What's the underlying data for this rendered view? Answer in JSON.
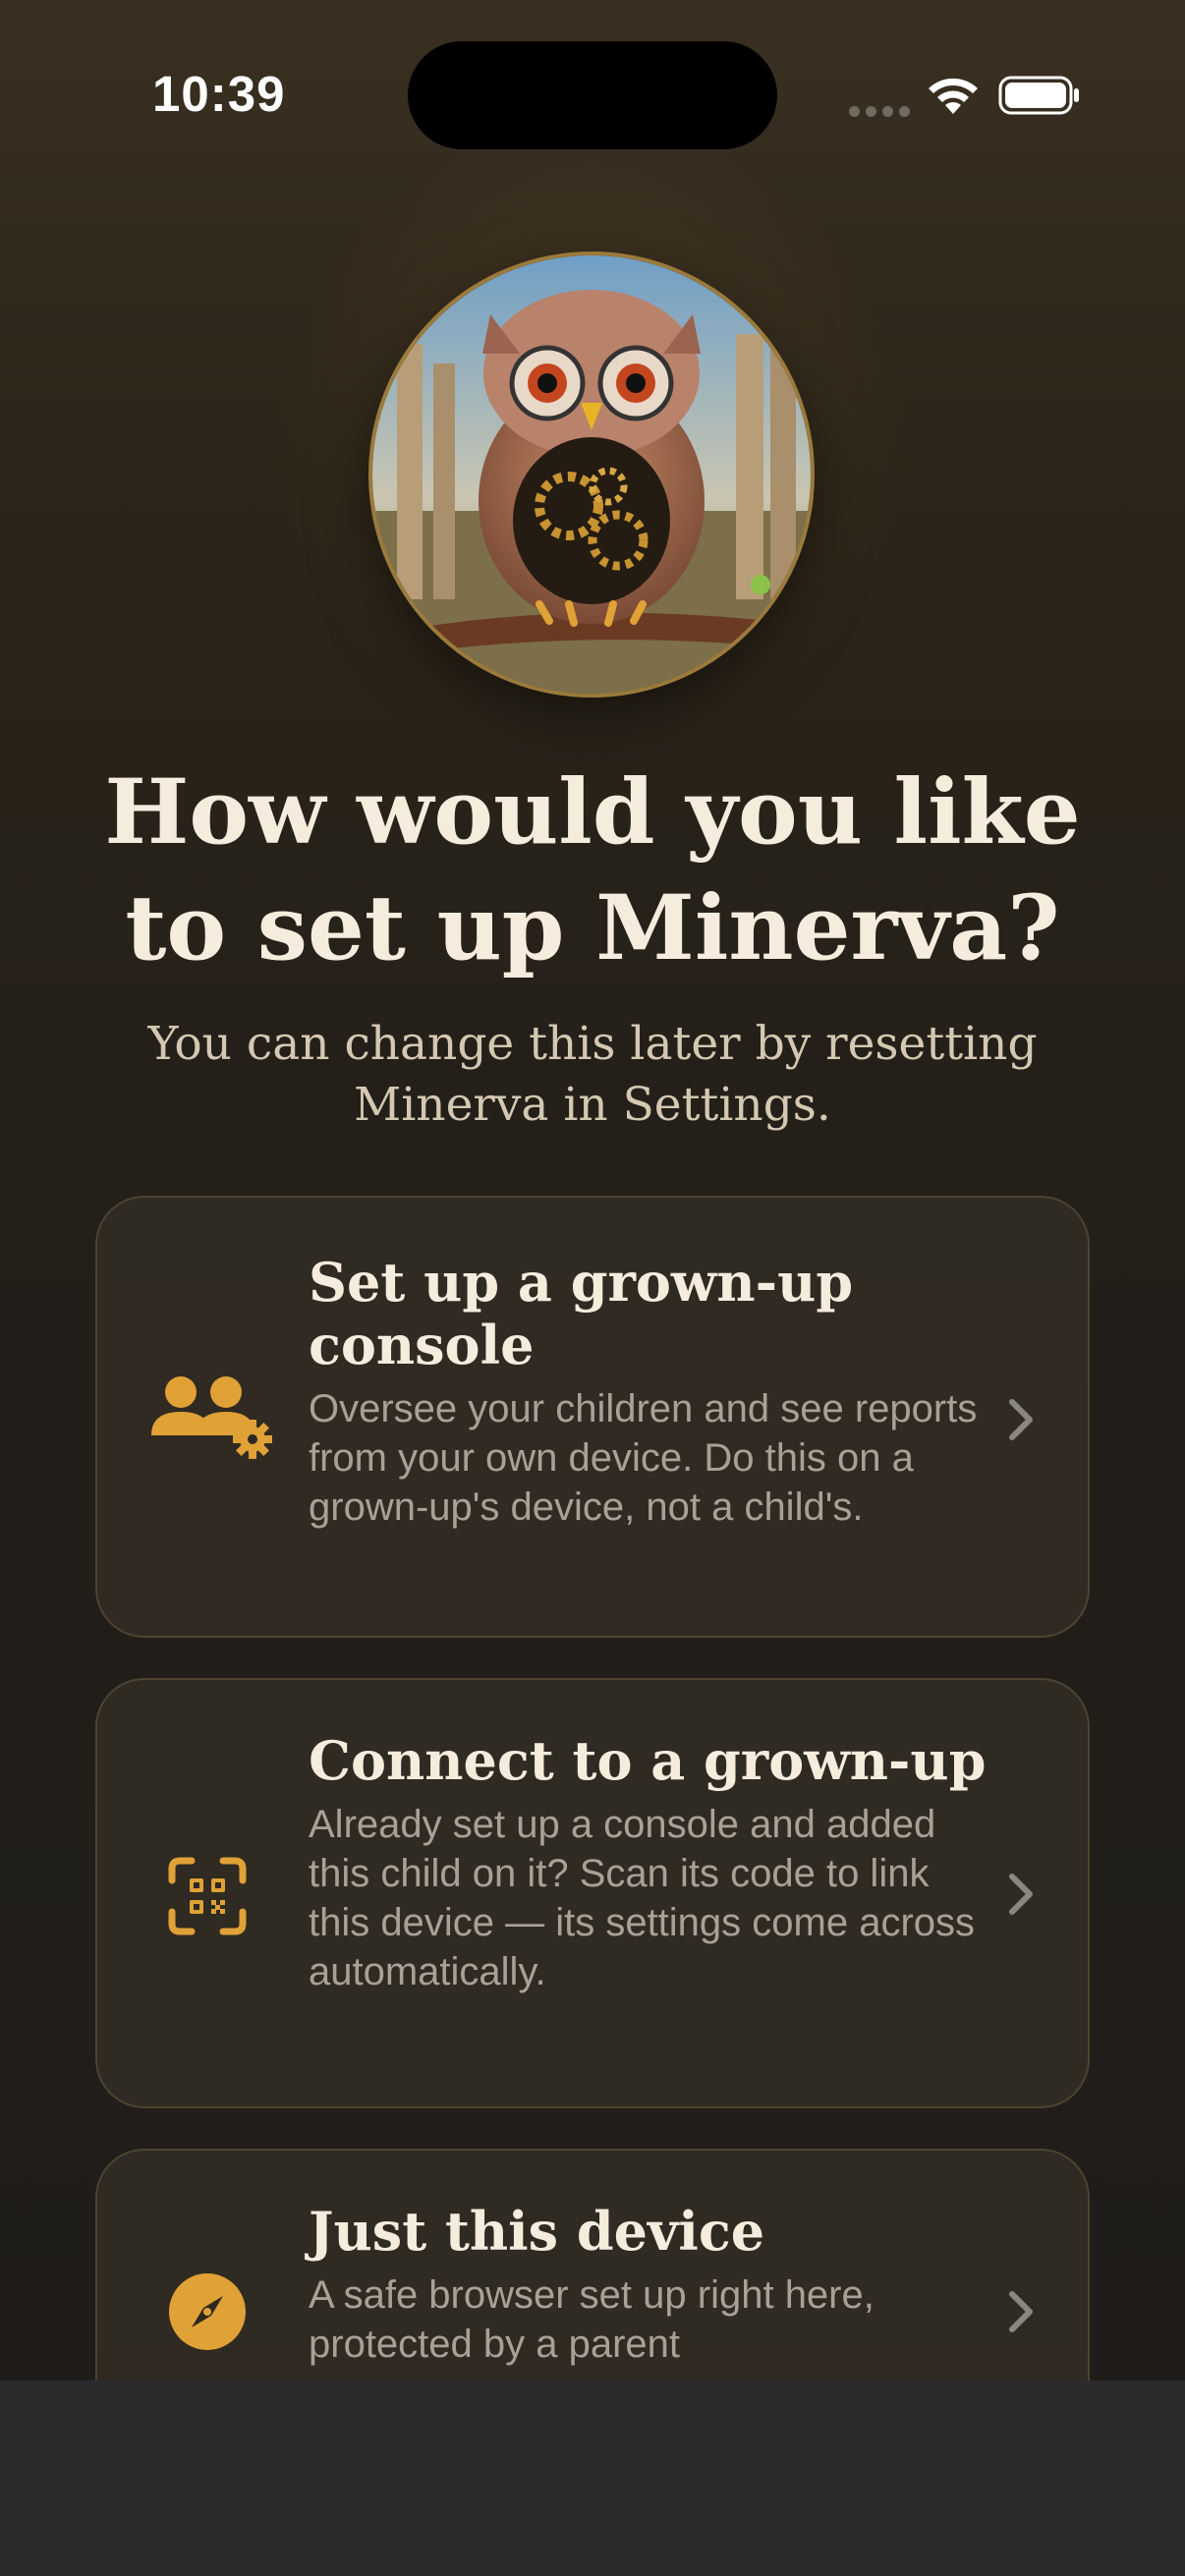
{
  "status_bar": {
    "time": "10:39",
    "signal_icon": "cellular-dots-icon",
    "wifi_icon": "wifi-icon",
    "battery_icon": "battery-full-icon"
  },
  "avatar": {
    "icon": "owl-mascot-image"
  },
  "heading": {
    "title_line1": "How would you like",
    "title_line2": "to set up Minerva?",
    "subtitle_line1": "You can change this later by resetting",
    "subtitle_line2": "Minerva in Settings."
  },
  "options": [
    {
      "title": "Set up a grown-up console",
      "description": "Oversee your children and see reports from your own device. Do this on a grown-up's device, not a child's.",
      "icon": "people-gear-icon"
    },
    {
      "title": "Connect to a grown-up",
      "description": "Already set up a console and added this child on it? Scan its code to link this device — its settings come across automatically.",
      "icon": "qr-scan-icon"
    },
    {
      "title": "Just this device",
      "description": "A safe browser set up right here, protected by a parent",
      "icon": "compass-icon"
    }
  ],
  "colors": {
    "accent": "#e0a137",
    "title_text": "#f6ecdd",
    "secondary_text": "#a8a196",
    "card_border": "#4e4331"
  }
}
